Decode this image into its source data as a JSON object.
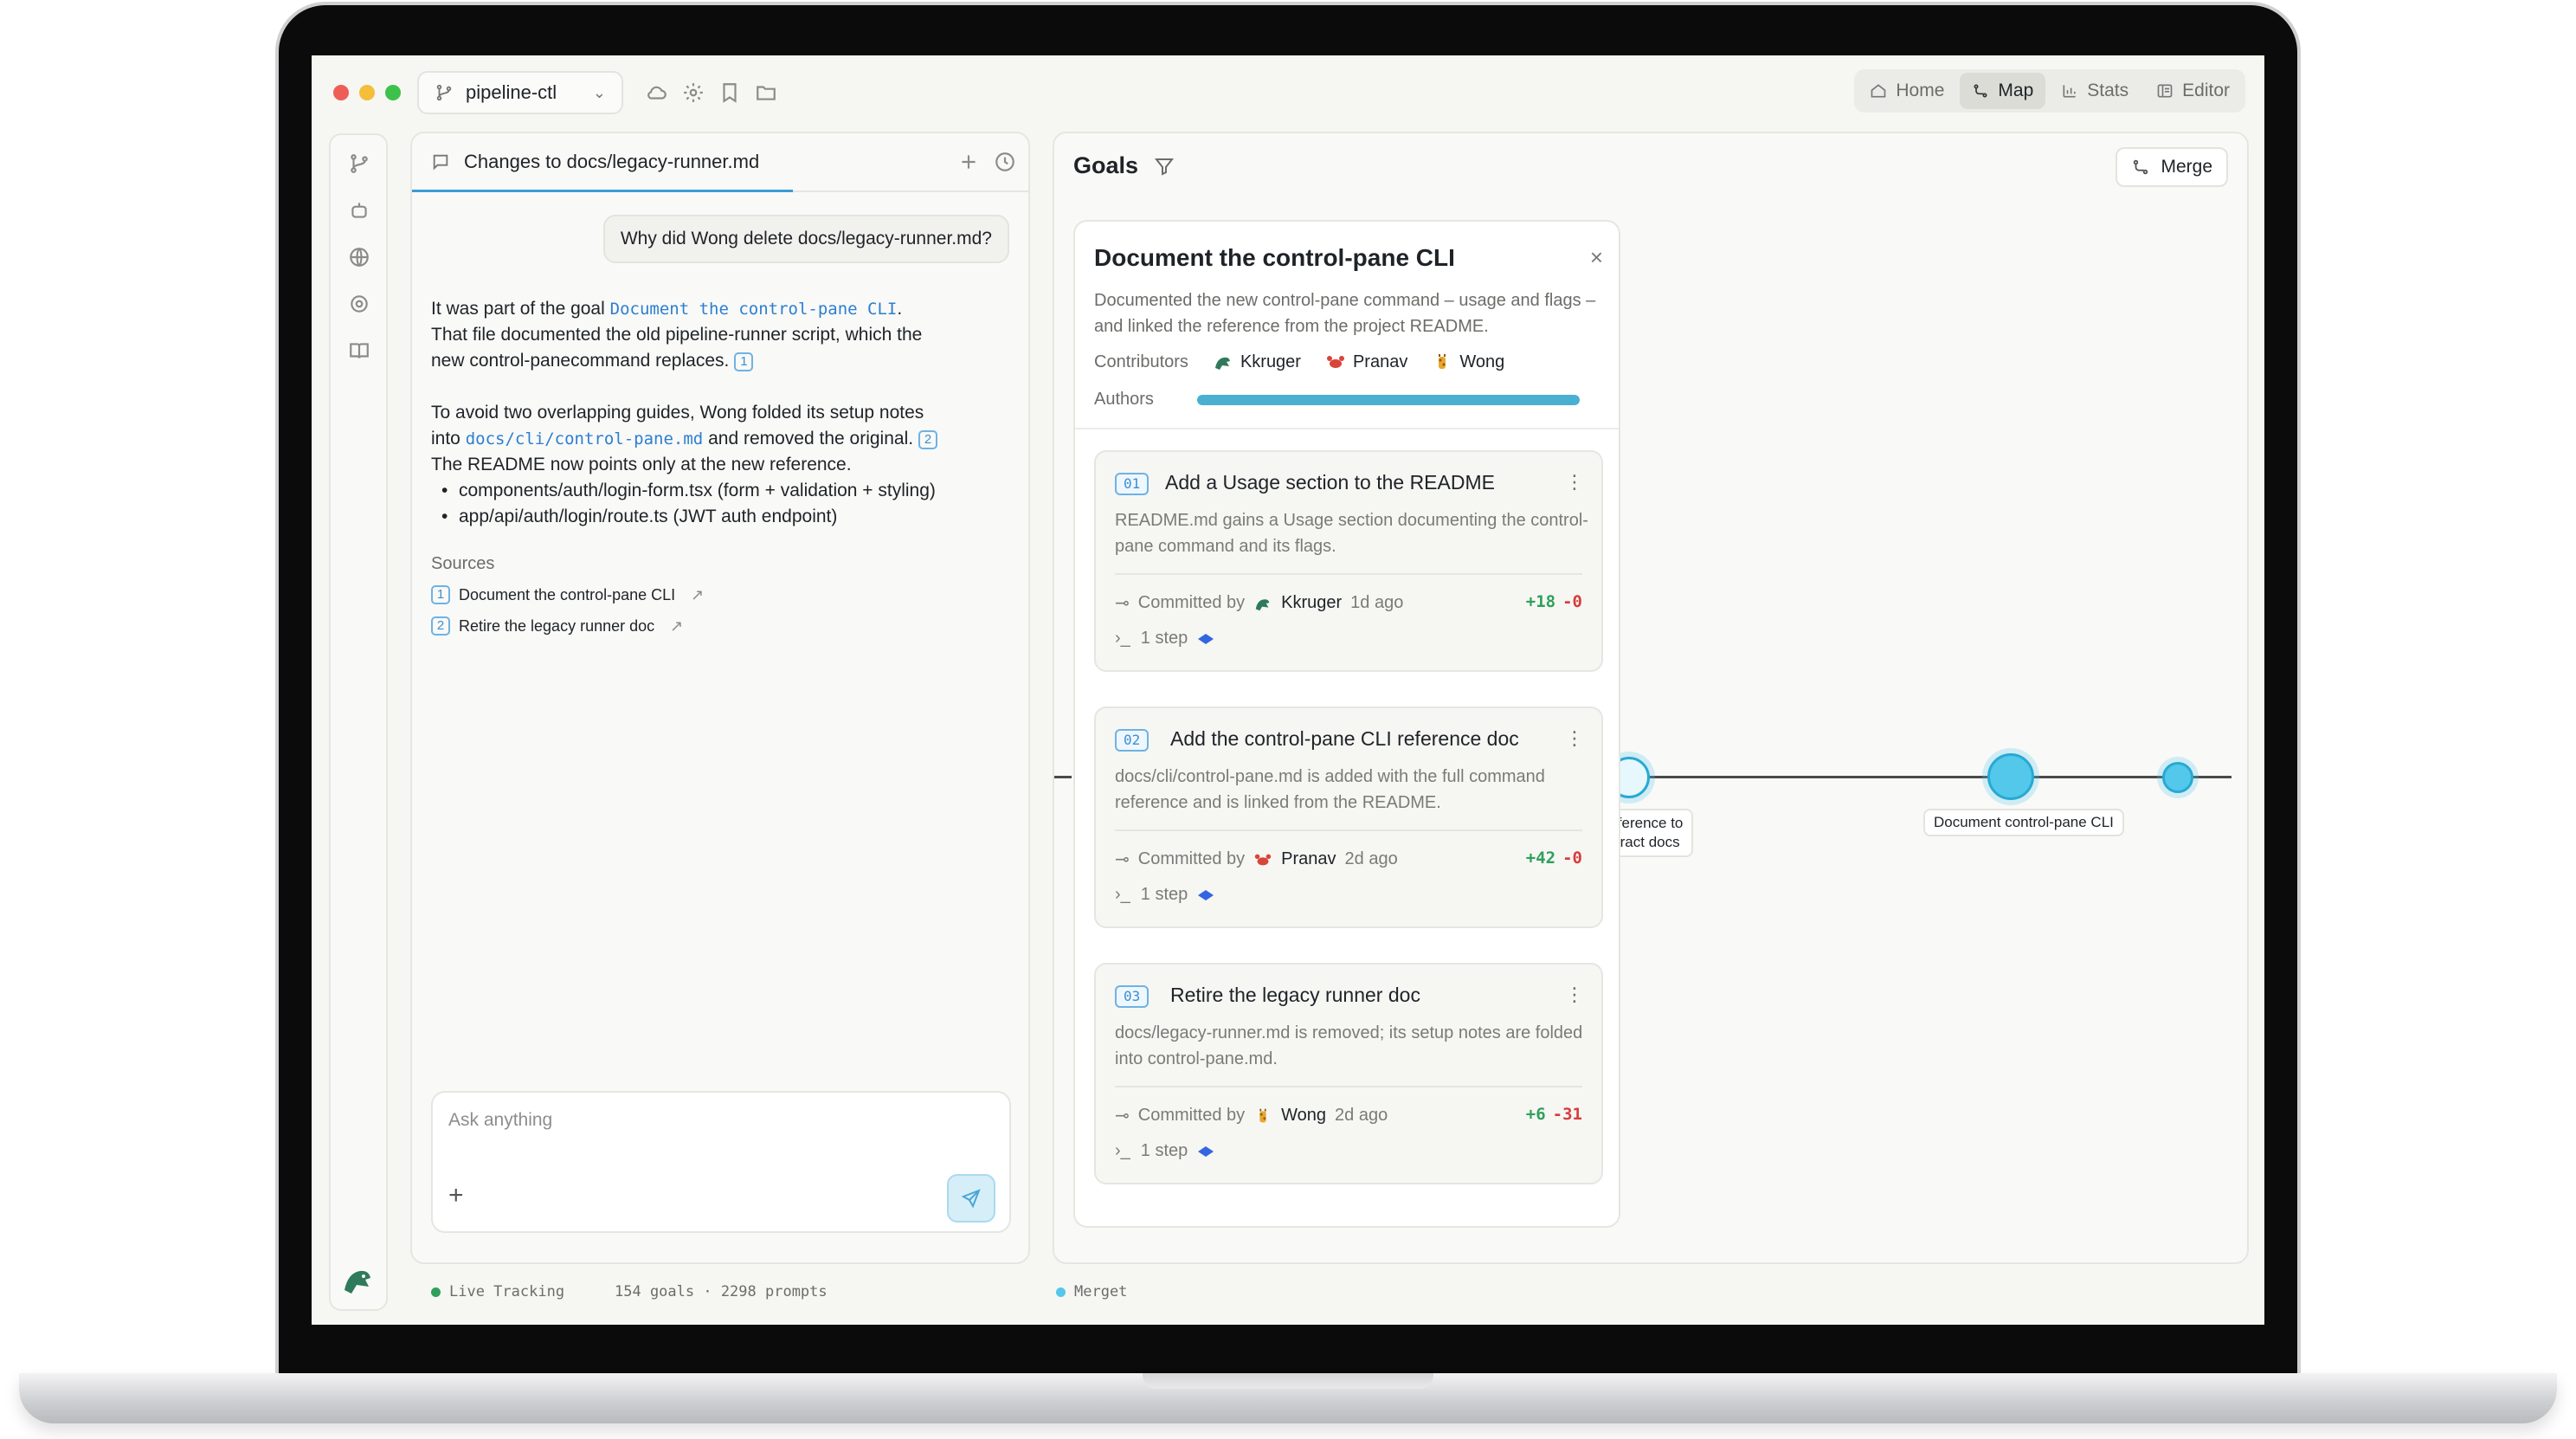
{
  "titlebar": {
    "repo": "pipeline-ctl",
    "nav": [
      {
        "label": "Home",
        "icon": "home-icon"
      },
      {
        "label": "Map",
        "icon": "map-icon",
        "active": true
      },
      {
        "label": "Stats",
        "icon": "chart-icon"
      },
      {
        "label": "Editor",
        "icon": "editor-icon"
      }
    ]
  },
  "chat": {
    "tab_title": "Changes to docs/legacy-runner.md",
    "question": "Why did Wong delete docs/legacy-runner.md?",
    "answer": {
      "p1_before": "It was part of the goal ",
      "p1_goal": "Document the control-pane CLI",
      "p1_after": ".",
      "p1_line2": "That file documented the old pipeline-runner script, which the",
      "p1_line3": "new control-panecommand replaces.",
      "cite1": "1",
      "p2_line1": "To avoid two overlapping guides, Wong folded its setup notes",
      "p2_into": "into ",
      "p2_path": "docs/cli/control-pane.md",
      "p2_after": " and removed the original.",
      "cite2": "2",
      "p2_line3": "The README now points only at the new reference.",
      "bullets": [
        "components/auth/login-form.tsx (form + validation + styling)",
        "app/api/auth/login/route.ts (JWT auth endpoint)"
      ]
    },
    "sources_title": "Sources",
    "sources": [
      {
        "num": "1",
        "label": "Document the control-pane CLI"
      },
      {
        "num": "2",
        "label": "Retire the legacy runner doc"
      }
    ],
    "input_placeholder": "Ask anything"
  },
  "status": {
    "live": "Live Tracking",
    "counts": "154 goals · 2298 prompts",
    "merget": "Merget",
    "live_color": "#2ea05b",
    "merget_color": "#53c8ea"
  },
  "goals": {
    "title": "Goals",
    "merge_label": "Merge",
    "card": {
      "title": "Document the control-pane CLI",
      "description": "Documented the new control-pane command – usage and flags – and linked the reference from the project README.",
      "contributors_label": "Contributors",
      "contributors": [
        "Kkruger",
        "Pranav",
        "Wong"
      ],
      "authors_label": "Authors",
      "authors_progress": 1.0
    },
    "commits": [
      {
        "num": "01",
        "title": "Add a Usage section to the README",
        "desc": "README.md gains a Usage section documenting the control-pane command and its flags.",
        "committed_by": "Committed by",
        "author": "Kkruger",
        "when": "1d ago",
        "additions": "+18",
        "deletions": "-0",
        "steps": "1 step"
      },
      {
        "num": "02",
        "title": "Add the control-pane CLI reference doc",
        "desc": "docs/cli/control-pane.md is added with the full command reference and is linked from the README.",
        "committed_by": "Committed by",
        "author": "Pranav",
        "when": "2d ago",
        "additions": "+42",
        "deletions": "-0",
        "steps": "1 step"
      },
      {
        "num": "03",
        "title": "Retire the legacy runner doc",
        "desc": "docs/legacy-runner.md is removed; its setup notes are folded into control-pane.md.",
        "committed_by": "Committed by",
        "author": "Wong",
        "when": "2d ago",
        "additions": "+6",
        "deletions": "-31",
        "steps": "1 step"
      }
    ],
    "graph_labels": {
      "partial_label_1": "-reference to",
      "partial_label_2": "ontract docs",
      "node_label": "Document control-pane CLI"
    }
  }
}
